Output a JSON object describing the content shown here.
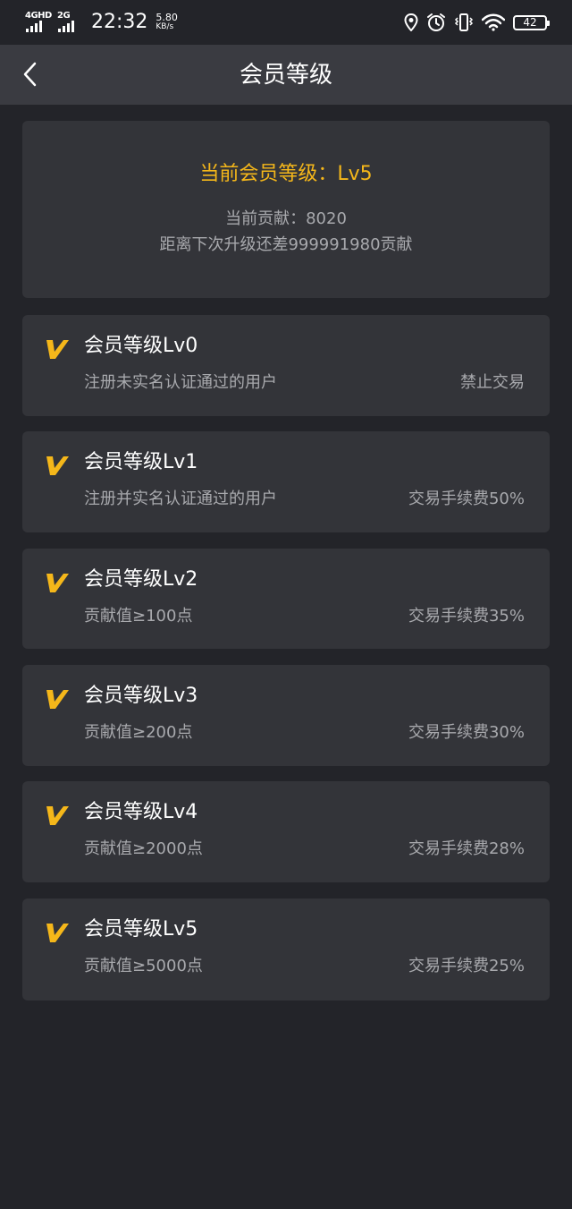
{
  "status_bar": {
    "network_1": "4GHD",
    "network_2": "2G",
    "time": "22:32",
    "speed_value": "5.80",
    "speed_unit": "KB/s",
    "battery": "42",
    "icons": [
      "location-icon",
      "alarm-icon",
      "vibrate-icon",
      "wifi-icon",
      "battery-icon"
    ]
  },
  "nav": {
    "title": "会员等级",
    "back_icon": "chevron-left-icon"
  },
  "summary": {
    "current_level": "当前会员等级：Lv5",
    "contribution": "当前贡献：8020",
    "next_level_gap": "距离下次升级还差999991980贡献"
  },
  "colors": {
    "accent": "#f5b71a",
    "background": "#232429",
    "card": "#333439",
    "nav_bar": "#3a3b41",
    "text_primary": "#ffffff",
    "text_secondary": "#a8a9ad"
  },
  "levels": [
    {
      "icon": "v-badge-icon",
      "name": "会员等级Lv0",
      "description": "注册未实名认证通过的用户",
      "fee": "禁止交易"
    },
    {
      "icon": "v-badge-icon",
      "name": "会员等级Lv1",
      "description": "注册并实名认证通过的用户",
      "fee": "交易手续费50%"
    },
    {
      "icon": "v-badge-icon",
      "name": "会员等级Lv2",
      "description": "贡献值≥100点",
      "fee": "交易手续费35%"
    },
    {
      "icon": "v-badge-icon",
      "name": "会员等级Lv3",
      "description": "贡献值≥200点",
      "fee": "交易手续费30%"
    },
    {
      "icon": "v-badge-icon",
      "name": "会员等级Lv4",
      "description": "贡献值≥2000点",
      "fee": "交易手续费28%"
    },
    {
      "icon": "v-badge-icon",
      "name": "会员等级Lv5",
      "description": "贡献值≥5000点",
      "fee": "交易手续费25%"
    }
  ]
}
